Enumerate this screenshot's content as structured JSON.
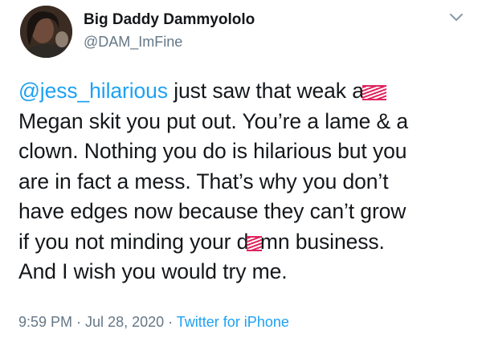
{
  "author": {
    "display_name": "Big Daddy Dammyololo",
    "handle": "@DAM_ImFine"
  },
  "tweet": {
    "mention": "@jess_hilarious",
    "line1_rest": " just saw that weak a",
    "line1_censored": "ss",
    "line2": "Megan skit you put out. You’re a lame & a",
    "line3": "clown. Nothing you do is hilarious but you",
    "line4": "are in fact a mess. That’s why you don’t",
    "line5": "have edges now because they can’t grow",
    "line6_pre": "if you not minding your d",
    "line6_censored": "a",
    "line6_post": "mn business.",
    "line7": "And I wish you would try me."
  },
  "meta": {
    "time": "9:59 PM",
    "sep1": " · ",
    "date": "Jul 28, 2020",
    "sep2": " · ",
    "source": "Twitter for iPhone"
  },
  "colors": {
    "link": "#1da1f2",
    "secondary_text": "#657786",
    "censor_scribble": "#e0245e"
  },
  "icons": {
    "menu": "chevron-down-icon"
  }
}
